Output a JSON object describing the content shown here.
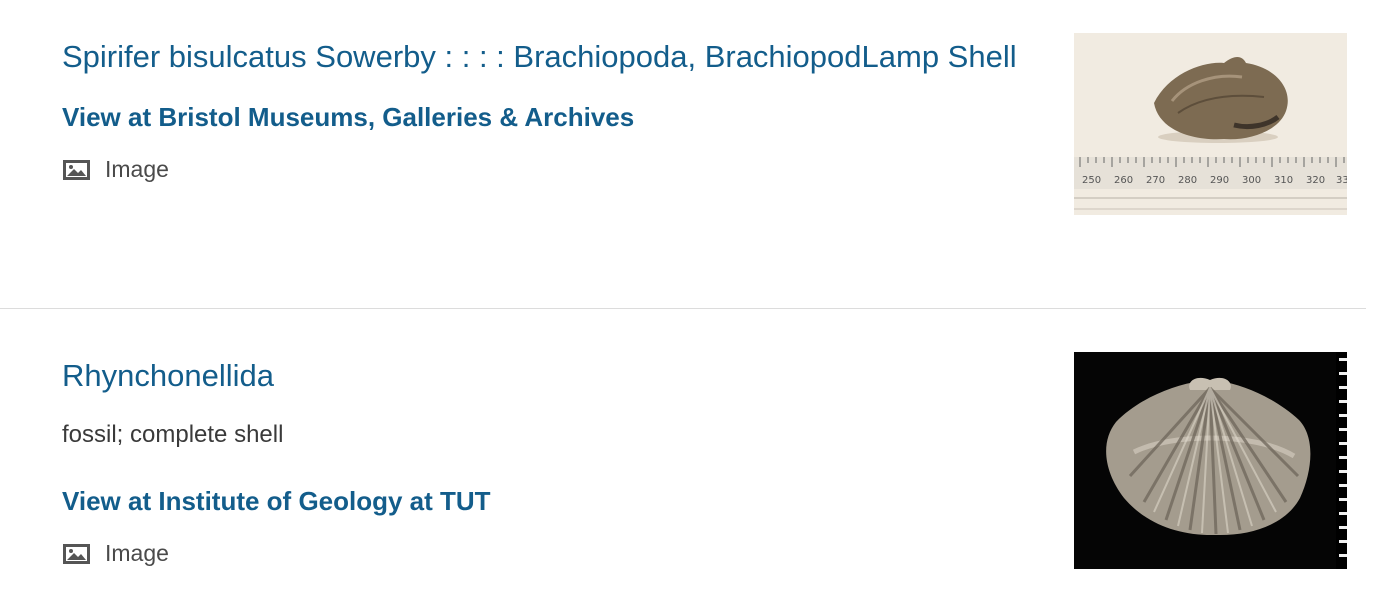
{
  "results": [
    {
      "title": "Spirifer bisulcatus Sowerby : : : : Brachiopoda, BrachiopodLamp Shell",
      "provider_link": "View at Bristol Museums, Galleries & Archives",
      "media_type": "Image",
      "media_icon": "image-icon",
      "thumbnail": {
        "subject": "fossil brachiopod on ruler",
        "ruler_labels": [
          "250",
          "260",
          "270",
          "280",
          "290",
          "300",
          "310",
          "320",
          "33"
        ]
      }
    },
    {
      "title": "Rhynchonellida",
      "description": "fossil; complete shell",
      "provider_link": "View at Institute of Geology at TUT",
      "media_type": "Image",
      "media_icon": "image-icon",
      "thumbnail": {
        "subject": "ribbed fossil shell on black background"
      }
    }
  ],
  "colors": {
    "link": "#135d8b",
    "text": "#3a3a3a",
    "divider": "#dcdcdc"
  }
}
